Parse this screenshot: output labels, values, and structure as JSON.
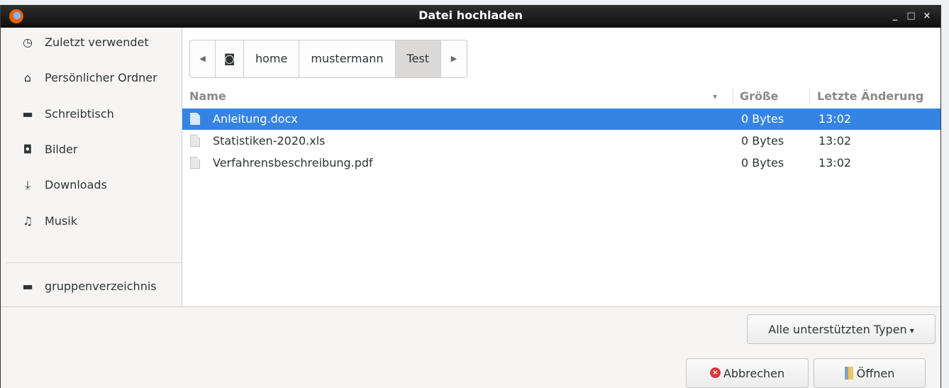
{
  "window": {
    "title": "Datei hochladen",
    "wm_buttons": [
      "_",
      "□",
      "×"
    ]
  },
  "sidebar": {
    "items": [
      {
        "label": "Zuletzt verwendet",
        "icon": "clock-icon",
        "glyph": "◷"
      },
      {
        "label": "Persönlicher Ordner",
        "icon": "home-icon",
        "glyph": "⌂"
      },
      {
        "label": "Schreibtisch",
        "icon": "folder-icon",
        "glyph": "▬"
      },
      {
        "label": "Bilder",
        "icon": "camera-icon",
        "glyph": "◘"
      },
      {
        "label": "Downloads",
        "icon": "download-icon",
        "glyph": "⤓"
      },
      {
        "label": "Musik",
        "icon": "music-icon",
        "glyph": "♫"
      },
      {
        "label": "gruppenverzeichnis",
        "icon": "folder-icon",
        "glyph": "▬"
      }
    ]
  },
  "pathbar": {
    "back": "◀",
    "disk": "◙",
    "segments": [
      "home",
      "mustermann",
      "Test"
    ],
    "active": "Test",
    "forward": "▶"
  },
  "columns": {
    "name": "Name",
    "sort_indicator": "▾",
    "size": "Größe",
    "modified": "Letzte Änderung"
  },
  "files": [
    {
      "name": "Anleitung.docx",
      "size": "0 Bytes",
      "modified": "13:02",
      "selected": true
    },
    {
      "name": "Statistiken-2020.xls",
      "size": "0 Bytes",
      "modified": "13:02",
      "selected": false
    },
    {
      "name": "Verfahrensbeschreibung.pdf",
      "size": "0 Bytes",
      "modified": "13:02",
      "selected": false
    }
  ],
  "filter": {
    "label": "Alle unterstützten Typen",
    "caret": "▾"
  },
  "buttons": {
    "cancel": "Abbrechen",
    "cancel_glyph": "×",
    "open": "Öffnen"
  },
  "colors": {
    "selection": "#3584e4",
    "titlebar": "#1a1a1a"
  }
}
